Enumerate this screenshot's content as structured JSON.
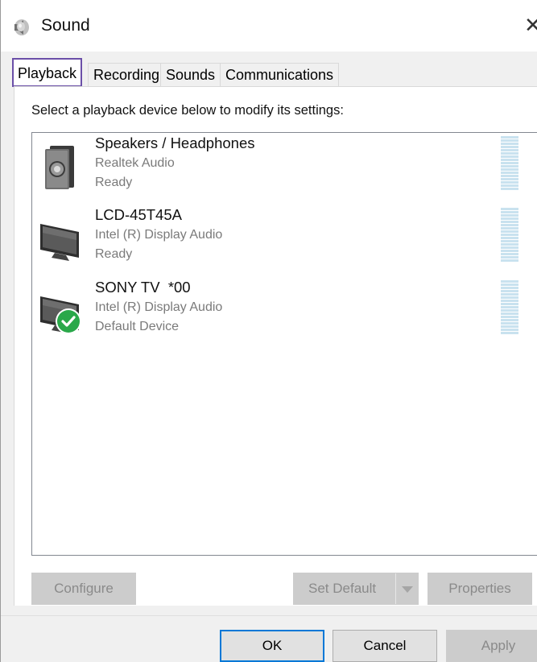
{
  "window": {
    "title": "Sound",
    "close_glyph": "✕"
  },
  "tabs": [
    {
      "label": "Playback",
      "active": true
    },
    {
      "label": "Recording",
      "active": false
    },
    {
      "label": "Sounds",
      "active": false
    },
    {
      "label": "Communications",
      "active": false
    }
  ],
  "playback": {
    "instructions": "Select a playback device below to modify its settings:",
    "devices": [
      {
        "name": "Speakers / Headphones",
        "driver": "Realtek Audio",
        "status": "Ready",
        "icon": "speaker-icon",
        "is_default": false
      },
      {
        "name": "LCD-45T45A",
        "driver": "Intel (R) Display Audio",
        "status": "Ready",
        "icon": "monitor-icon",
        "is_default": false
      },
      {
        "name": "SONY TV  *00",
        "driver": "Intel (R) Display Audio",
        "status": "Default Device",
        "icon": "monitor-icon",
        "is_default": true
      }
    ]
  },
  "buttons": {
    "configure": "Configure",
    "set_default": "Set Default",
    "properties": "Properties",
    "ok": "OK",
    "cancel": "Cancel",
    "apply": "Apply"
  },
  "colors": {
    "active_tab_border": "#6b4fa8",
    "default_check": "#2aa84a",
    "meter": "#c9e2ef",
    "focus_border": "#0078d7"
  }
}
